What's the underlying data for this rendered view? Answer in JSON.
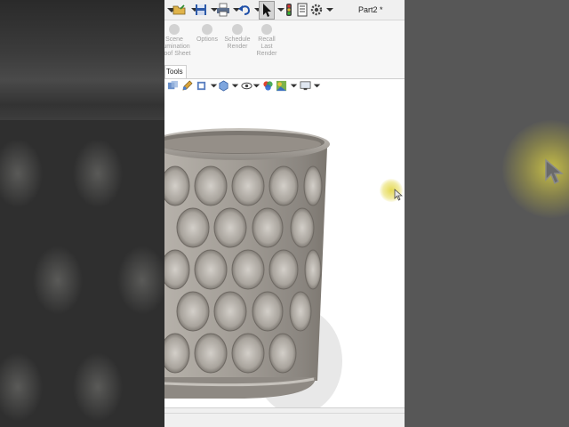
{
  "toolbar": {
    "document_title": "Part2 *",
    "icons": [
      "new-arrow-icon",
      "save-icon",
      "print-icon",
      "undo-icon",
      "select-arrow-icon",
      "traffic-light-icon",
      "file-properties-icon",
      "options-gear-icon"
    ]
  },
  "ribbon": {
    "buttons": [
      {
        "label": "Scene\nIllumination\nProof Sheet",
        "enabled": false
      },
      {
        "label": "Options",
        "enabled": false
      },
      {
        "label": "Schedule\nRender",
        "enabled": false
      },
      {
        "label": "Recall\nLast\nRender",
        "enabled": false
      }
    ]
  },
  "tabs": {
    "active": "Tools"
  },
  "viewport": {
    "model": "textured cylindrical planter",
    "colors": {
      "model": "#9d9891",
      "background": "#ffffff",
      "cursor_highlight": "#e4d84a"
    }
  }
}
